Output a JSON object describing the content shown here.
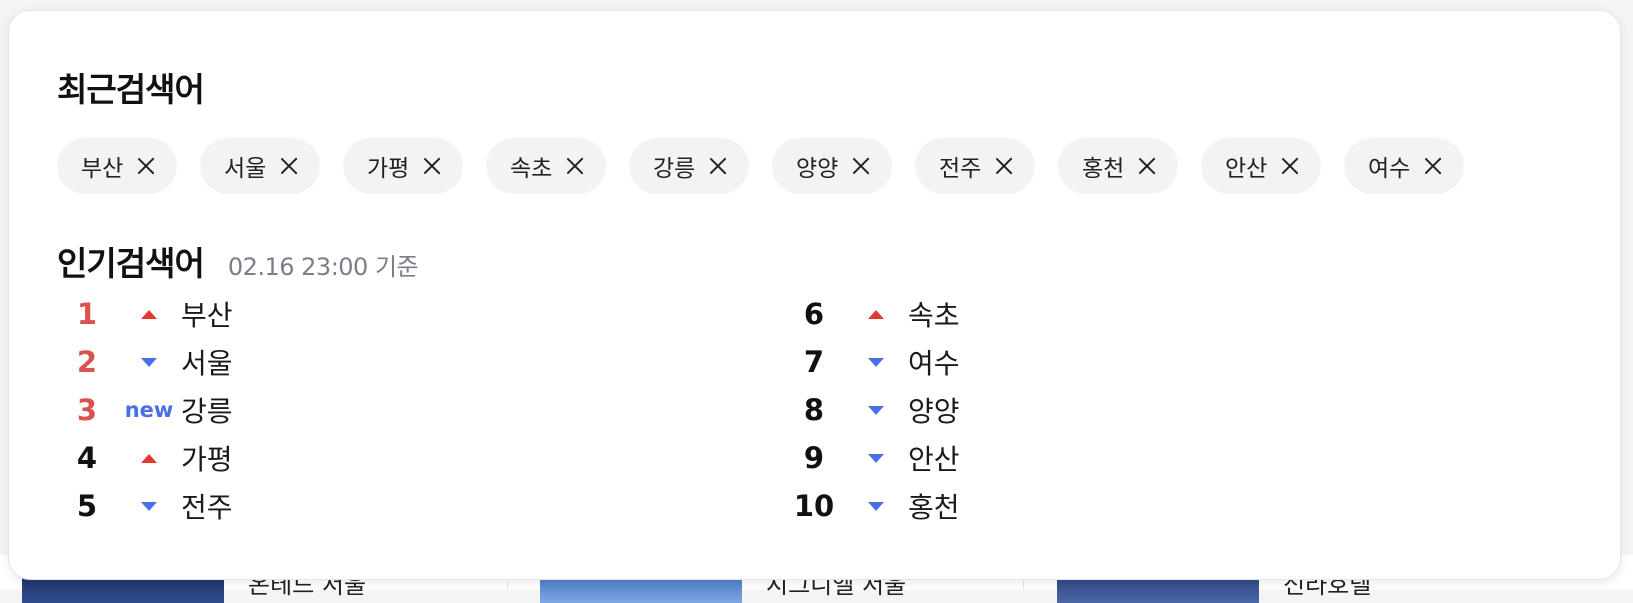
{
  "recent": {
    "title": "최근검색어",
    "chips": [
      {
        "label": "부산"
      },
      {
        "label": "서울"
      },
      {
        "label": "가평"
      },
      {
        "label": "속초"
      },
      {
        "label": "강릉"
      },
      {
        "label": "양양"
      },
      {
        "label": "전주"
      },
      {
        "label": "홍천"
      },
      {
        "label": "안산"
      },
      {
        "label": "여수"
      }
    ],
    "close_icon": "close-icon"
  },
  "popular": {
    "title": "인기검색어",
    "timestamp": "02.16 23:00 기준",
    "items": [
      {
        "rank": "1",
        "change": "up",
        "keyword": "부산"
      },
      {
        "rank": "2",
        "change": "down",
        "keyword": "서울"
      },
      {
        "rank": "3",
        "change": "new",
        "change_label": "new",
        "keyword": "강릉"
      },
      {
        "rank": "4",
        "change": "up",
        "keyword": "가평"
      },
      {
        "rank": "5",
        "change": "down",
        "keyword": "전주"
      },
      {
        "rank": "6",
        "change": "up",
        "keyword": "속초"
      },
      {
        "rank": "7",
        "change": "down",
        "keyword": "여수"
      },
      {
        "rank": "8",
        "change": "down",
        "keyword": "양양"
      },
      {
        "rank": "9",
        "change": "down",
        "keyword": "안산"
      },
      {
        "rank": "10",
        "change": "down",
        "keyword": "홍천"
      }
    ]
  },
  "colors": {
    "top_rank": "#d9534f",
    "arrow_up": "#e03b2f",
    "arrow_down": "#4a6fe3",
    "chip_bg": "#f2f3f5"
  },
  "background": {
    "cards": [
      {
        "title": "온테드 서울"
      },
      {
        "title": "시그니엘 서울"
      },
      {
        "title": "신라호텔"
      }
    ]
  }
}
